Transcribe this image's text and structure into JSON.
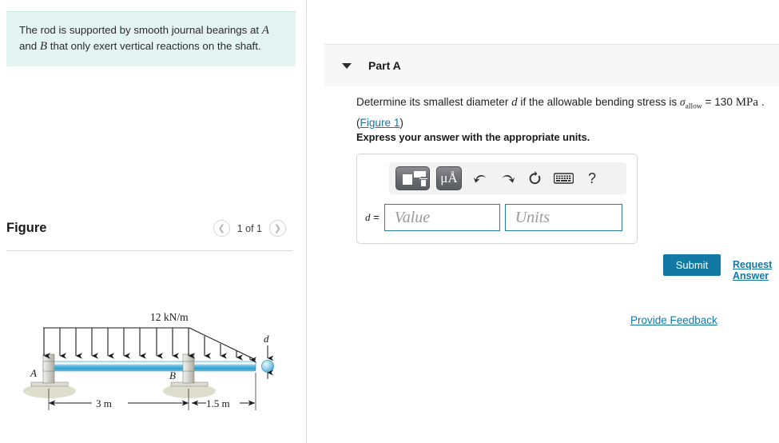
{
  "left_panel": {
    "statement": {
      "line1_a": "The rod is supported by smooth journal bearings at ",
      "var_a": "A",
      "line2_a": "and ",
      "var_b": "B",
      "line2_b": " that only exert vertical reactions on the shaft."
    },
    "figure": {
      "title": "Figure",
      "counter": "1 of 1",
      "prev_icon": "chevron-left-icon",
      "next_icon": "chevron-right-icon",
      "diagram": {
        "load_label": "12 kN/m",
        "support_a_label": "A",
        "support_b_label": "B",
        "diameter_label": "d",
        "dim_left": "3 m",
        "dim_right": "1.5 m",
        "beam_color": "#4db4e0",
        "ground_color": "#dedecd"
      }
    }
  },
  "right_panel": {
    "part": {
      "caret_icon": "caret-down-icon",
      "title": "Part A"
    },
    "question": {
      "text_a": "Determine its smallest diameter ",
      "var_d": "d",
      "text_b": " if the allowable bending stress is ",
      "sigma": "σ",
      "sigma_sub": "allow",
      "text_c": " = 130 ",
      "unit": "MPa",
      "text_d": " .",
      "figure_link": "Figure 1"
    },
    "express_note": "Express your answer with the appropriate units.",
    "toolbar": {
      "template_icon": "math-template-icon",
      "units_icon": "micro-angstrom-icon",
      "units_label": "μÅ",
      "undo_icon": "undo-arrow-icon",
      "redo_icon": "redo-arrow-icon",
      "reset_icon": "reset-circular-arrow-icon",
      "keyboard_icon": "keyboard-icon",
      "help_icon": "question-mark-icon",
      "help_label": "?"
    },
    "answer": {
      "label": "d =",
      "value_placeholder": "Value",
      "units_placeholder": "Units"
    },
    "submit_label": "Submit",
    "request_answer_label": "Request Answer",
    "provide_feedback_label": "Provide Feedback"
  },
  "colors": {
    "accent_link": "#1378a5",
    "submit_bg": "#1279a4",
    "statement_bg": "#e3f4f1",
    "part_header_bg": "#f7f7f7"
  }
}
